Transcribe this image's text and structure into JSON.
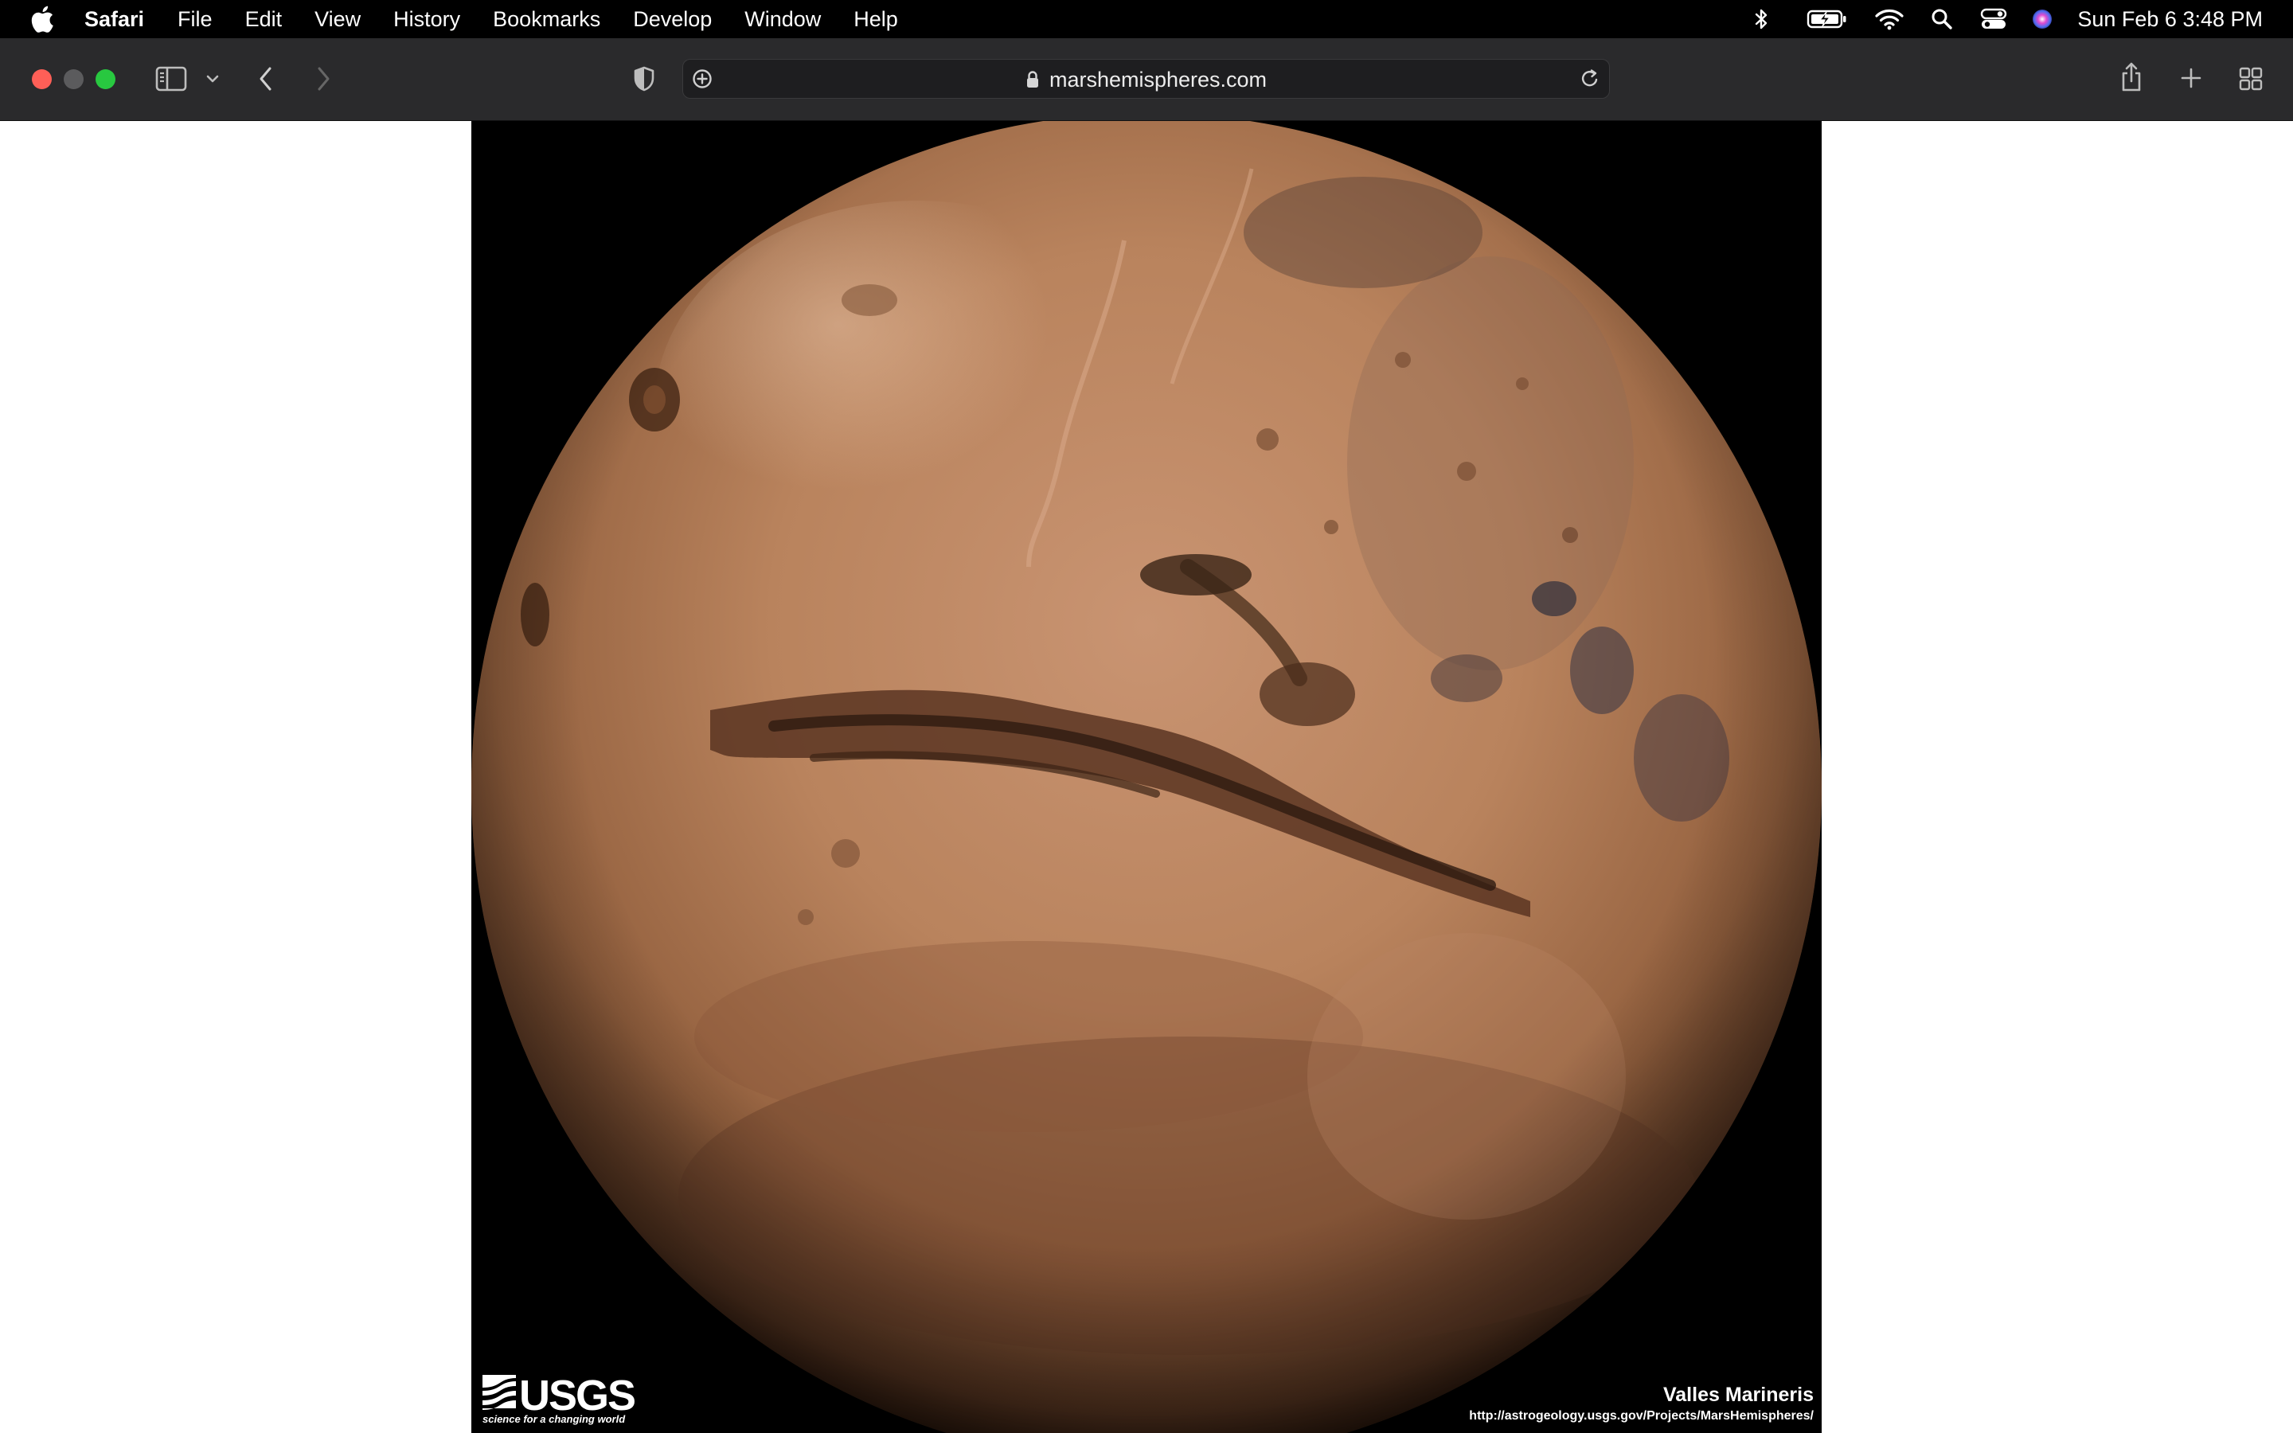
{
  "menubar": {
    "app_name": "Safari",
    "items": [
      "File",
      "Edit",
      "View",
      "History",
      "Bookmarks",
      "Develop",
      "Window",
      "Help"
    ],
    "status_icons": [
      "bluetooth-icon",
      "battery-icon",
      "wifi-icon",
      "search-icon",
      "control-center-icon",
      "siri-icon"
    ],
    "clock": "Sun Feb 6  3:48 PM"
  },
  "toolbar": {
    "url": "marshemispheres.com"
  },
  "image": {
    "logo_text": "USGS",
    "logo_tagline": "science for a changing world",
    "caption_title": "Valles Marineris",
    "caption_url": "http://astrogeology.usgs.gov/Projects/MarsHemispheres/"
  },
  "colors": {
    "menubar_bg": "#000000",
    "toolbar_bg": "#2a2a2c",
    "close": "#ff5f57",
    "minimize": "#5b5b5d",
    "zoom": "#28c840",
    "mars_surface": "#b9835d"
  }
}
